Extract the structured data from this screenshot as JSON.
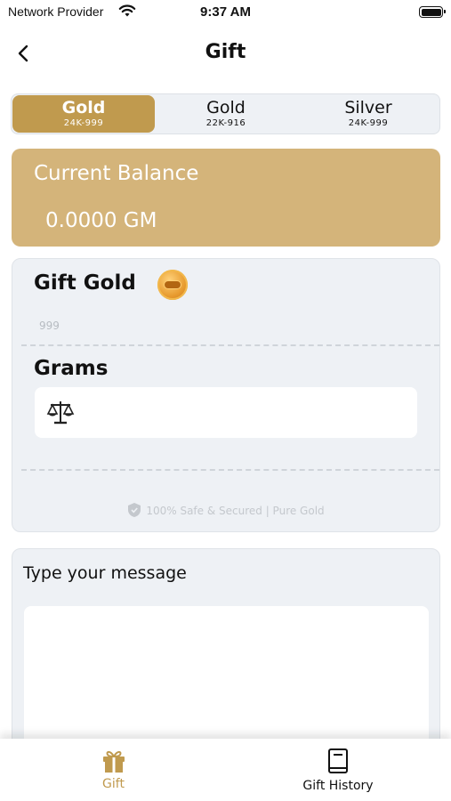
{
  "status_bar": {
    "carrier": "Network Provider",
    "time": "9:37 AM"
  },
  "nav": {
    "title": "Gift"
  },
  "metal_tabs": [
    {
      "name": "Gold",
      "purity": "24K-999",
      "active": true
    },
    {
      "name": "Gold",
      "purity": "22K-916",
      "active": false
    },
    {
      "name": "Silver",
      "purity": "24K-999",
      "active": false
    }
  ],
  "balance": {
    "label": "Current Balance",
    "value": "0.0000 GM"
  },
  "gift_card": {
    "heading": "Gift Gold",
    "purity_hint": "999",
    "grams_label": "Grams",
    "grams_value": "",
    "secure_note": "100% Safe & Secured | Pure Gold"
  },
  "message": {
    "label": "Type your message",
    "value": ""
  },
  "tabbar": {
    "gift_label": "Gift",
    "history_label": "Gift History"
  },
  "colors": {
    "accent": "#c09a4e",
    "balance_bg": "#d4b47a",
    "card_bg": "#eef1f5"
  }
}
